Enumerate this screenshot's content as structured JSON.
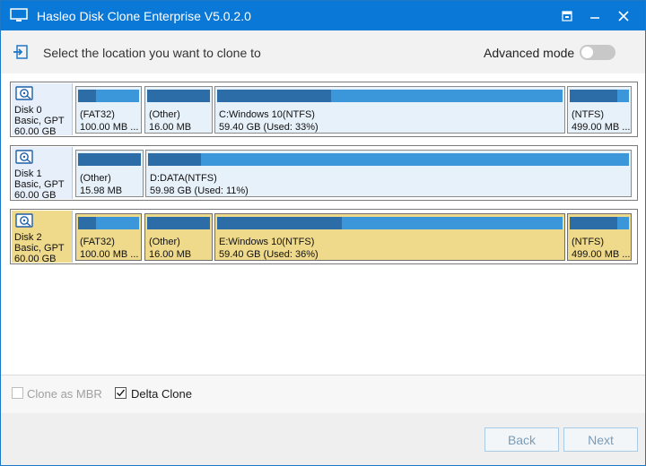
{
  "window": {
    "title": "Hasleo Disk Clone Enterprise V5.0.2.0",
    "icons": [
      "app-icon",
      "restore-icon",
      "minimize-icon",
      "close-icon"
    ]
  },
  "header": {
    "instruction": "Select the location you want to clone to",
    "advanced_mode_label": "Advanced mode",
    "advanced_mode_on": false
  },
  "disks": [
    {
      "name": "Disk 0",
      "type": "Basic, GPT",
      "size": "60.00 GB",
      "selected": false,
      "partitions": [
        {
          "label": "(FAT32)",
          "size": "100.00 MB ...",
          "used_fraction": 0.3
        },
        {
          "label": "(Other)",
          "size": "16.00 MB",
          "used_fraction": 1.0
        },
        {
          "label": "C:Windows 10(NTFS)",
          "size": "59.40 GB (Used: 33%)",
          "used_fraction": 0.33
        },
        {
          "label": "(NTFS)",
          "size": "499.00 MB ...",
          "used_fraction": 0.8
        }
      ]
    },
    {
      "name": "Disk 1",
      "type": "Basic, GPT",
      "size": "60.00 GB",
      "selected": false,
      "partitions": [
        {
          "label": "(Other)",
          "size": "15.98 MB",
          "used_fraction": 1.0
        },
        {
          "label": "D:DATA(NTFS)",
          "size": "59.98 GB (Used: 11%)",
          "used_fraction": 0.11
        }
      ]
    },
    {
      "name": "Disk 2",
      "type": "Basic, GPT",
      "size": "60.00 GB",
      "selected": true,
      "partitions": [
        {
          "label": "(FAT32)",
          "size": "100.00 MB ...",
          "used_fraction": 0.3
        },
        {
          "label": "(Other)",
          "size": "16.00 MB",
          "used_fraction": 1.0
        },
        {
          "label": "E:Windows 10(NTFS)",
          "size": "59.40 GB (Used: 36%)",
          "used_fraction": 0.36
        },
        {
          "label": "(NTFS)",
          "size": "499.00 MB ...",
          "used_fraction": 0.8
        }
      ]
    }
  ],
  "options": {
    "clone_as_mbr": {
      "label": "Clone as MBR",
      "checked": false,
      "enabled": false
    },
    "delta_clone": {
      "label": "Delta Clone",
      "checked": true,
      "enabled": true
    }
  },
  "footer": {
    "back_label": "Back",
    "next_label": "Next"
  },
  "colors": {
    "title_bar": "#0a78d7",
    "partition_bar_free": "#3c96da",
    "partition_bar_used": "#2c6da8",
    "partition_bg": "#e7f1fa",
    "selected_bg": "#efd98a"
  }
}
